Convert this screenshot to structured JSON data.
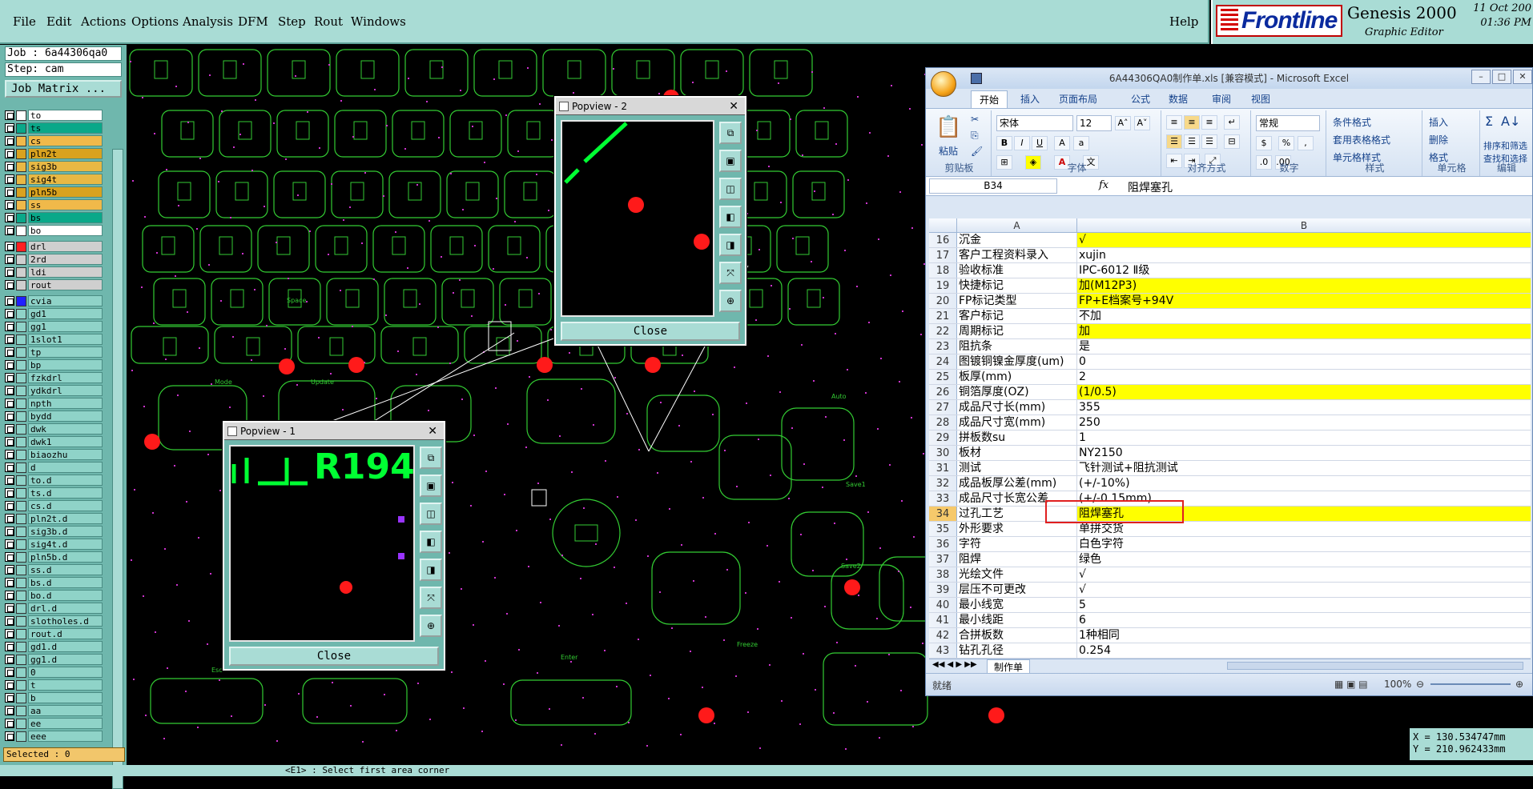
{
  "menu": {
    "file": "File",
    "edit": "Edit",
    "actions": "Actions",
    "options": "Options",
    "analysis": "Analysis",
    "dfm": "DFM",
    "step": "Step",
    "rout": "Rout",
    "windows": "Windows",
    "help": "Help"
  },
  "brand": {
    "logo": "Frontline",
    "title": "Genesis 2000",
    "subtitle": "Graphic Editor",
    "date": "11 Oct 200",
    "time": "01:36 PM"
  },
  "job": {
    "job": "Job : 6a44306qa0",
    "step": "Step: cam",
    "matrix": "Job Matrix ..."
  },
  "layers": [
    {
      "name": "to",
      "color": "#ffffff",
      "bg": "#ffffff"
    },
    {
      "name": "ts",
      "color": "#0aa889",
      "bg": "#0aa889"
    },
    {
      "name": "cs",
      "color": "#f0b94a",
      "bg": "#f0b94a"
    },
    {
      "name": "pln2t",
      "color": "#d9a21f",
      "bg": "#d9a21f"
    },
    {
      "name": "sig3b",
      "color": "#e8b844",
      "bg": "#e8b844"
    },
    {
      "name": "sig4t",
      "color": "#e8b844",
      "bg": "#e8b844"
    },
    {
      "name": "pln5b",
      "color": "#d9a21f",
      "bg": "#d9a21f"
    },
    {
      "name": "ss",
      "color": "#f0b94a",
      "bg": "#f0b94a"
    },
    {
      "name": "bs",
      "color": "#0aa889",
      "bg": "#0aa889"
    },
    {
      "name": "bo",
      "color": "#ffffff",
      "bg": "#ffffff"
    },
    {
      "name": "drl",
      "color": "#ff2020",
      "bg": "#cfcfcf"
    },
    {
      "name": "2rd",
      "color": "#cfcfcf",
      "bg": "#cfcfcf"
    },
    {
      "name": "ldi",
      "color": "#cfcfcf",
      "bg": "#cfcfcf"
    },
    {
      "name": "rout",
      "color": "#cfcfcf",
      "bg": "#cfcfcf"
    },
    {
      "name": "cvia",
      "color": "#2020ff",
      "bg": "#8fd3c8"
    },
    {
      "name": "gd1",
      "color": "#8fd3c8",
      "bg": "#8fd3c8"
    },
    {
      "name": "gg1",
      "color": "#8fd3c8",
      "bg": "#8fd3c8"
    },
    {
      "name": "1slot1",
      "color": "#8fd3c8",
      "bg": "#8fd3c8"
    },
    {
      "name": "tp",
      "color": "#8fd3c8",
      "bg": "#8fd3c8"
    },
    {
      "name": "bp",
      "color": "#8fd3c8",
      "bg": "#8fd3c8"
    },
    {
      "name": "fzkdrl",
      "color": "#8fd3c8",
      "bg": "#8fd3c8"
    },
    {
      "name": "ydkdrl",
      "color": "#8fd3c8",
      "bg": "#8fd3c8"
    },
    {
      "name": "npth",
      "color": "#8fd3c8",
      "bg": "#8fd3c8"
    },
    {
      "name": "bydd",
      "color": "#8fd3c8",
      "bg": "#8fd3c8"
    },
    {
      "name": "dwk",
      "color": "#8fd3c8",
      "bg": "#8fd3c8"
    },
    {
      "name": "dwk1",
      "color": "#8fd3c8",
      "bg": "#8fd3c8"
    },
    {
      "name": "biaozhu",
      "color": "#8fd3c8",
      "bg": "#8fd3c8"
    },
    {
      "name": "d",
      "color": "#8fd3c8",
      "bg": "#8fd3c8"
    },
    {
      "name": "to.d",
      "color": "#8fd3c8",
      "bg": "#8fd3c8"
    },
    {
      "name": "ts.d",
      "color": "#8fd3c8",
      "bg": "#8fd3c8"
    },
    {
      "name": "cs.d",
      "color": "#8fd3c8",
      "bg": "#8fd3c8"
    },
    {
      "name": "pln2t.d",
      "color": "#8fd3c8",
      "bg": "#8fd3c8"
    },
    {
      "name": "sig3b.d",
      "color": "#8fd3c8",
      "bg": "#8fd3c8"
    },
    {
      "name": "sig4t.d",
      "color": "#8fd3c8",
      "bg": "#8fd3c8"
    },
    {
      "name": "pln5b.d",
      "color": "#8fd3c8",
      "bg": "#8fd3c8"
    },
    {
      "name": "ss.d",
      "color": "#8fd3c8",
      "bg": "#8fd3c8"
    },
    {
      "name": "bs.d",
      "color": "#8fd3c8",
      "bg": "#8fd3c8"
    },
    {
      "name": "bo.d",
      "color": "#8fd3c8",
      "bg": "#8fd3c8"
    },
    {
      "name": "drl.d",
      "color": "#8fd3c8",
      "bg": "#8fd3c8"
    },
    {
      "name": "slotholes.d",
      "color": "#8fd3c8",
      "bg": "#8fd3c8"
    },
    {
      "name": "rout.d",
      "color": "#8fd3c8",
      "bg": "#8fd3c8"
    },
    {
      "name": "gd1.d",
      "color": "#8fd3c8",
      "bg": "#8fd3c8"
    },
    {
      "name": "gg1.d",
      "color": "#8fd3c8",
      "bg": "#8fd3c8"
    },
    {
      "name": "0",
      "color": "#8fd3c8",
      "bg": "#8fd3c8"
    },
    {
      "name": "t",
      "color": "#8fd3c8",
      "bg": "#8fd3c8"
    },
    {
      "name": "b",
      "color": "#8fd3c8",
      "bg": "#8fd3c8"
    },
    {
      "name": "aa",
      "color": "#8fd3c8",
      "bg": "#8fd3c8"
    },
    {
      "name": "ee",
      "color": "#8fd3c8",
      "bg": "#8fd3c8"
    },
    {
      "name": "eee",
      "color": "#8fd3c8",
      "bg": "#8fd3c8"
    }
  ],
  "selected": "Selected : 0",
  "popup1": {
    "title": "Popview - 1",
    "label": "R194",
    "close": "Close"
  },
  "popup2": {
    "title": "Popview - 2",
    "close": "Close"
  },
  "coords": {
    "x": "X = 130.534747mm",
    "y": "Y = 210.962433mm"
  },
  "bottom": {
    "prompt": "<E1> : Select first area corner"
  },
  "pcb_labels": [
    "Enter",
    "Space",
    "Mode",
    "Update",
    "Auto",
    "Save1",
    "Save2",
    "Freeze",
    "Esc"
  ],
  "excel": {
    "title": "6A44306QA0制作单.xls [兼容模式] - Microsoft Excel",
    "tabs": [
      "开始",
      "插入",
      "页面布局",
      "公式",
      "数据",
      "审阅",
      "视图"
    ],
    "font": "宋体",
    "size": "12",
    "numfmt": "常规",
    "groups": {
      "clipboard": "剪贴板",
      "font": "字体",
      "align": "对齐方式",
      "number": "数字",
      "styles": "样式",
      "cells": "单元格",
      "edit": "编辑"
    },
    "ribbon": {
      "paste": "粘贴",
      "cond": "条件格式",
      "table": "套用表格格式",
      "cellstyle": "单元格样式",
      "insert": "插入",
      "delete": "删除",
      "format": "格式",
      "sort": "排序和筛选",
      "find": "查找和选择"
    },
    "namebox": "B34",
    "fx": "fx",
    "formula": "阻焊塞孔",
    "colA": "A",
    "colB": "B",
    "rows": [
      {
        "n": "16",
        "a": "沉金",
        "b": "√",
        "y": true
      },
      {
        "n": "17",
        "a": "客户工程资料录入",
        "b": "xujin",
        "y": false
      },
      {
        "n": "18",
        "a": "验收标准",
        "b": "IPC-6012 Ⅱ级",
        "y": false
      },
      {
        "n": "19",
        "a": "快捷标记",
        "b": "加(M12P3)",
        "y": true
      },
      {
        "n": "20",
        "a": "FP标记类型",
        "b": "FP+E档案号+94V",
        "y": true
      },
      {
        "n": "21",
        "a": "客户标记",
        "b": "不加",
        "y": false
      },
      {
        "n": "22",
        "a": "周期标记",
        "b": "加",
        "y": true
      },
      {
        "n": "23",
        "a": "阻抗条",
        "b": "是",
        "y": false
      },
      {
        "n": "24",
        "a": "图镀铜镍金厚度(um)",
        "b": "0",
        "y": false
      },
      {
        "n": "25",
        "a": "板厚(mm)",
        "b": "2",
        "y": false
      },
      {
        "n": "26",
        "a": "铜箔厚度(OZ)",
        "b": "(1/0.5)",
        "y": true
      },
      {
        "n": "27",
        "a": "成品尺寸长(mm)",
        "b": "355",
        "y": false
      },
      {
        "n": "28",
        "a": "成品尺寸宽(mm)",
        "b": "250",
        "y": false
      },
      {
        "n": "29",
        "a": "拼板数su",
        "b": "1",
        "y": false
      },
      {
        "n": "30",
        "a": "板材",
        "b": "NY2150",
        "y": false
      },
      {
        "n": "31",
        "a": "测试",
        "b": "飞针测试+阻抗测试",
        "y": false
      },
      {
        "n": "32",
        "a": "成品板厚公差(mm)",
        "b": "(+/-10%)",
        "y": false
      },
      {
        "n": "33",
        "a": "成品尺寸长宽公差",
        "b": "(+/-0.15mm)",
        "y": false
      },
      {
        "n": "34",
        "a": "过孔工艺",
        "b": "阻焊塞孔",
        "y": true,
        "sel": true
      },
      {
        "n": "35",
        "a": "外形要求",
        "b": "单拼交货",
        "y": false
      },
      {
        "n": "36",
        "a": "字符",
        "b": "白色字符",
        "y": false
      },
      {
        "n": "37",
        "a": "阻焊",
        "b": "绿色",
        "y": false
      },
      {
        "n": "38",
        "a": "光绘文件",
        "b": "√",
        "y": false
      },
      {
        "n": "39",
        "a": "层压不可更改",
        "b": "√",
        "y": false
      },
      {
        "n": "40",
        "a": "最小线宽",
        "b": "5",
        "y": false
      },
      {
        "n": "41",
        "a": "最小线距",
        "b": "6",
        "y": false
      },
      {
        "n": "42",
        "a": "合拼板数",
        "b": "1种相同",
        "y": false
      },
      {
        "n": "43",
        "a": "钻孔孔径",
        "b": "0.254",
        "y": false
      }
    ],
    "sheet": "制作单",
    "status": "就绪",
    "zoom": "100%"
  }
}
